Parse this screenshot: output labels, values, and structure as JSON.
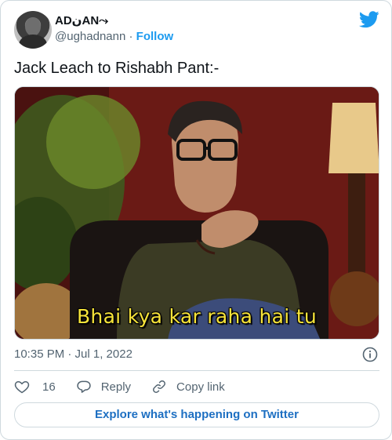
{
  "author": {
    "display_name": "ADنAN⤳",
    "handle": "@ughadnann",
    "follow_label": "Follow",
    "separator": "·"
  },
  "tweet": {
    "text": "Jack Leach to Rishabh Pant:-",
    "media_caption": "Bhai kya kar raha hai tu",
    "timestamp": "10:35 PM · Jul 1, 2022"
  },
  "actions": {
    "like_count": "16",
    "reply_label": "Reply",
    "copy_link_label": "Copy link"
  },
  "footer": {
    "explore_label": "Explore what's happening on Twitter"
  },
  "icons": {
    "brand": "twitter-bird-icon",
    "info": "info-icon",
    "like": "heart-icon",
    "reply": "speech-bubble-icon",
    "copy": "link-icon"
  },
  "colors": {
    "accent": "#1d9bf0",
    "text": "#0f1419",
    "muted": "#536471",
    "border": "#cfd9de",
    "caption": "#f7e43a"
  }
}
